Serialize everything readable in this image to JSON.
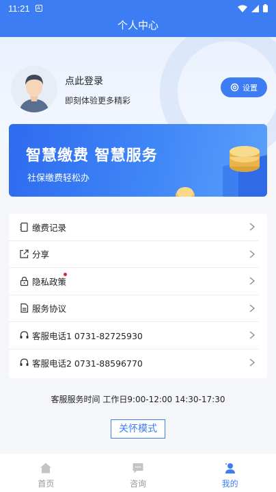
{
  "status_bar": {
    "time": "11:21",
    "notif_letter": "A"
  },
  "header": {
    "title": "个人中心"
  },
  "profile": {
    "login_title": "点此登录",
    "login_subtitle": "即刻体验更多精彩",
    "settings_label": "设置"
  },
  "banner": {
    "title": "智慧缴费  智慧服务",
    "subtitle": "社保缴费轻松办"
  },
  "menu": {
    "items": [
      {
        "label": "缴费记录",
        "icon": "receipt-icon"
      },
      {
        "label": "分享",
        "icon": "share-icon"
      },
      {
        "label": "隐私政策",
        "icon": "lock-icon",
        "badge_dot": true
      },
      {
        "label": "服务协议",
        "icon": "document-icon"
      },
      {
        "label": "客服电话1 0731-82725930",
        "icon": "headset-icon"
      },
      {
        "label": "客服电话2 0731-88596770",
        "icon": "headset-icon"
      }
    ]
  },
  "service_time": "客服服务时间 工作日9:00-12:00 14:30-17:30",
  "care_mode_label": "关怀模式",
  "tabbar": {
    "tabs": [
      {
        "label": "首页",
        "icon": "home-icon",
        "active": false
      },
      {
        "label": "咨询",
        "icon": "chat-icon",
        "active": false
      },
      {
        "label": "我的",
        "icon": "user-icon",
        "active": true
      }
    ]
  },
  "colors": {
    "primary": "#3d7df3",
    "badge": "#e0262c",
    "text": "#222222"
  }
}
